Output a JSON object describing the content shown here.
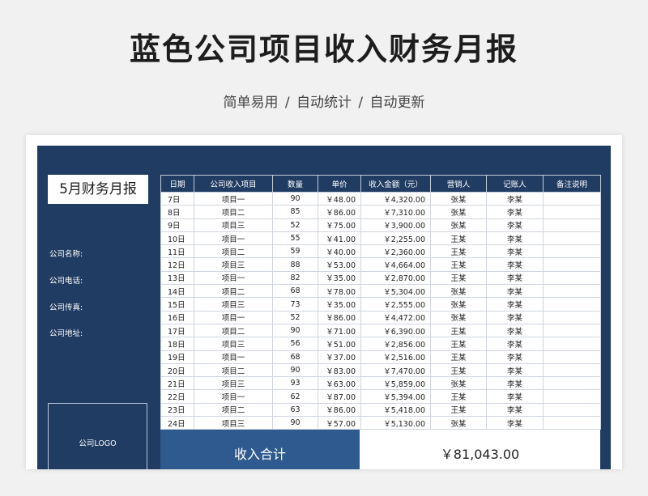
{
  "page": {
    "title": "蓝色公司项目收入财务月报",
    "subtitle": "简单易用 / 自动统计 / 自动更新"
  },
  "sheet": {
    "report_title": "5月财务月报",
    "company_name_label": "公司名称:",
    "company_phone_label": "公司电话:",
    "company_fax_label": "公司传真:",
    "company_address_label": "公司地址:",
    "logo_label": "公司LOGO"
  },
  "table": {
    "headers": [
      "日期",
      "公司收入项目",
      "数量",
      "单价",
      "收入金额（元）",
      "营销人",
      "记账人",
      "备注说明"
    ],
    "rows": [
      [
        "7日",
        "项目一",
        "90",
        "￥48.00",
        "￥4,320.00",
        "张某",
        "李某",
        ""
      ],
      [
        "8日",
        "项目二",
        "85",
        "￥86.00",
        "￥7,310.00",
        "张某",
        "李某",
        ""
      ],
      [
        "9日",
        "项目三",
        "52",
        "￥75.00",
        "￥3,900.00",
        "张某",
        "李某",
        ""
      ],
      [
        "10日",
        "项目一",
        "55",
        "￥41.00",
        "￥2,255.00",
        "王某",
        "李某",
        ""
      ],
      [
        "11日",
        "项目二",
        "59",
        "￥40.00",
        "￥2,360.00",
        "王某",
        "李某",
        ""
      ],
      [
        "12日",
        "项目三",
        "88",
        "￥53.00",
        "￥4,664.00",
        "王某",
        "李某",
        ""
      ],
      [
        "13日",
        "项目一",
        "82",
        "￥35.00",
        "￥2,870.00",
        "王某",
        "李某",
        ""
      ],
      [
        "14日",
        "项目二",
        "68",
        "￥78.00",
        "￥5,304.00",
        "张某",
        "李某",
        ""
      ],
      [
        "15日",
        "项目三",
        "73",
        "￥35.00",
        "￥2,555.00",
        "张某",
        "李某",
        ""
      ],
      [
        "16日",
        "项目一",
        "52",
        "￥86.00",
        "￥4,472.00",
        "张某",
        "李某",
        ""
      ],
      [
        "17日",
        "项目二",
        "90",
        "￥71.00",
        "￥6,390.00",
        "王某",
        "李某",
        ""
      ],
      [
        "18日",
        "项目三",
        "56",
        "￥51.00",
        "￥2,856.00",
        "王某",
        "李某",
        ""
      ],
      [
        "19日",
        "项目一",
        "68",
        "￥37.00",
        "￥2,516.00",
        "王某",
        "李某",
        ""
      ],
      [
        "20日",
        "项目二",
        "90",
        "￥83.00",
        "￥7,470.00",
        "王某",
        "李某",
        ""
      ],
      [
        "21日",
        "项目三",
        "93",
        "￥63.00",
        "￥5,859.00",
        "张某",
        "李某",
        ""
      ],
      [
        "22日",
        "项目一",
        "62",
        "￥87.00",
        "￥5,394.00",
        "王某",
        "李某",
        ""
      ],
      [
        "23日",
        "项目二",
        "63",
        "￥86.00",
        "￥5,418.00",
        "王某",
        "李某",
        ""
      ],
      [
        "24日",
        "项目三",
        "90",
        "￥57.00",
        "￥5,130.00",
        "张某",
        "李某",
        ""
      ]
    ]
  },
  "total": {
    "label": "收入合计",
    "value": "￥81,043.00"
  },
  "colors": {
    "sheet_background": "#213c63",
    "total_label_background": "#2e5a8f"
  }
}
